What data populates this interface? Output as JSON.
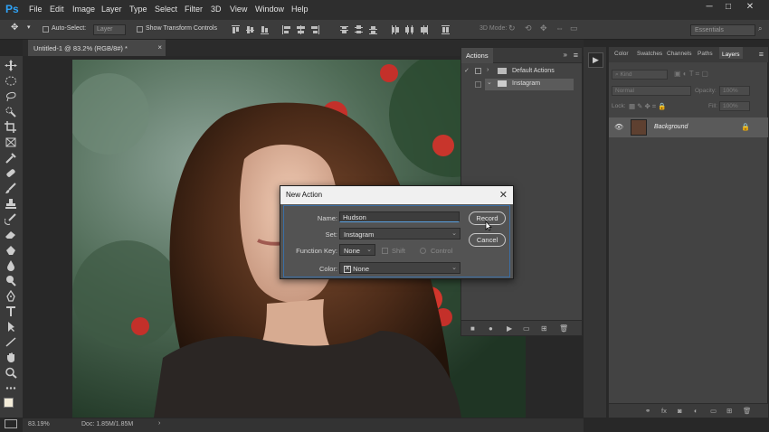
{
  "app": {
    "logo": "Ps"
  },
  "menu": [
    "File",
    "Edit",
    "Image",
    "Layer",
    "Type",
    "Select",
    "Filter",
    "3D",
    "View",
    "Window",
    "Help"
  ],
  "window_controls": [
    "─",
    "□",
    "✕"
  ],
  "options_bar": {
    "auto_select_label": "Auto-Select:",
    "auto_select_value": "Layer",
    "show_transform_label": "Show Transform Controls",
    "mode_3d_label": "3D Mode:",
    "workspace": "Essentials"
  },
  "document": {
    "tab_title": "Untitled-1 @ 83.2% (RGB/8#) *",
    "close": "×"
  },
  "status": {
    "zoom": "83.19%",
    "doc": "Doc: 1.85M/1.85M"
  },
  "actions_panel": {
    "title": "Actions",
    "menu_icon": "≡",
    "collapse": "»",
    "sets": [
      {
        "name": "Default Actions",
        "expanded": false,
        "selected": false
      },
      {
        "name": "Instagram",
        "expanded": true,
        "selected": true
      }
    ]
  },
  "layers_panel": {
    "tabs": [
      "Color",
      "Swatches",
      "Channels",
      "Paths",
      "Layers"
    ],
    "active_tab": "Layers",
    "kind_placeholder": "Kind",
    "blend_mode": "Normal",
    "opacity_label": "Opacity:",
    "opacity_value": "100%",
    "lock_label": "Lock:",
    "fill_label": "Fill:",
    "fill_value": "100%",
    "layers": [
      {
        "name": "Background",
        "visible": true,
        "locked": true
      }
    ]
  },
  "dialog": {
    "title": "New Action",
    "name_label": "Name:",
    "name_value": "Hudson",
    "set_label": "Set:",
    "set_value": "Instagram",
    "fkey_label": "Function Key:",
    "fkey_value": "None",
    "shift_label": "Shift",
    "control_label": "Control",
    "color_label": "Color:",
    "color_value": "None",
    "record_label": "Record",
    "cancel_label": "Cancel",
    "close": "✕"
  },
  "colors": {
    "accent_ps": "#2fa3f7",
    "focus_border": "#3a6ea5",
    "foreground_swatch": "#f3ecd9",
    "background_swatch": "#1a1a1a"
  }
}
